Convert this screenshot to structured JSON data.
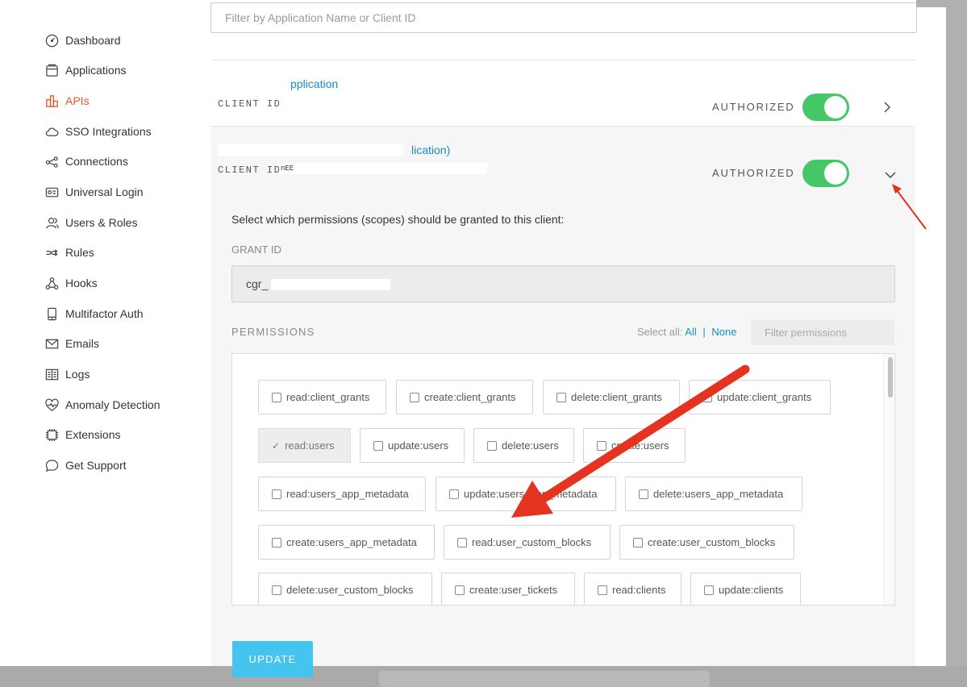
{
  "sidebar": {
    "items": [
      {
        "label": "Dashboard",
        "icon": "dashboard-icon",
        "active": false
      },
      {
        "label": "Applications",
        "icon": "applications-icon",
        "active": false
      },
      {
        "label": "APIs",
        "icon": "apis-icon",
        "active": true
      },
      {
        "label": "SSO Integrations",
        "icon": "cloud-icon",
        "active": false
      },
      {
        "label": "Connections",
        "icon": "connections-icon",
        "active": false
      },
      {
        "label": "Universal Login",
        "icon": "universal-login-icon",
        "active": false
      },
      {
        "label": "Users & Roles",
        "icon": "users-icon",
        "active": false
      },
      {
        "label": "Rules",
        "icon": "rules-icon",
        "active": false
      },
      {
        "label": "Hooks",
        "icon": "hooks-icon",
        "active": false
      },
      {
        "label": "Multifactor Auth",
        "icon": "phone-icon",
        "active": false
      },
      {
        "label": "Emails",
        "icon": "email-icon",
        "active": false
      },
      {
        "label": "Logs",
        "icon": "logs-icon",
        "active": false
      },
      {
        "label": "Anomaly Detection",
        "icon": "heart-icon",
        "active": false
      },
      {
        "label": "Extensions",
        "icon": "extensions-icon",
        "active": false
      },
      {
        "label": "Get Support",
        "icon": "chat-bubble-icon",
        "active": false
      }
    ]
  },
  "search": {
    "placeholder": "Filter by Application Name or Client ID"
  },
  "apps": [
    {
      "name_visible": "pplication",
      "client_id_label": "CLIENT ID:",
      "client_id_visible": "",
      "status": "AUTHORIZED",
      "authorized": true,
      "expanded": false
    },
    {
      "name_visible": "lication)",
      "client_id_label": "CLIENT ID:",
      "client_id_visible": "nEE",
      "status": "AUTHORIZED",
      "authorized": true,
      "expanded": true
    }
  ],
  "panel": {
    "title": "Select which permissions (scopes) should be granted to this client:",
    "grant_label": "GRANT ID",
    "grant_value": "cgr_",
    "permissions_label": "PERMISSIONS",
    "select_all_label": "Select all:",
    "all_label": "All",
    "separator": "|",
    "none_label": "None",
    "filter_placeholder": "Filter permissions",
    "permissions": [
      {
        "label": "read:client_grants",
        "checked": false
      },
      {
        "label": "create:client_grants",
        "checked": false
      },
      {
        "label": "delete:client_grants",
        "checked": false
      },
      {
        "label": "update:client_grants",
        "checked": false
      },
      {
        "label": "read:users",
        "checked": true
      },
      {
        "label": "update:users",
        "checked": false
      },
      {
        "label": "delete:users",
        "checked": false
      },
      {
        "label": "create:users",
        "checked": false
      },
      {
        "label": "read:users_app_metadata",
        "checked": false
      },
      {
        "label": "update:users_app_metadata",
        "checked": false
      },
      {
        "label": "delete:users_app_metadata",
        "checked": false
      },
      {
        "label": "create:users_app_metadata",
        "checked": false
      },
      {
        "label": "read:user_custom_blocks",
        "checked": false
      },
      {
        "label": "create:user_custom_blocks",
        "checked": false
      },
      {
        "label": "delete:user_custom_blocks",
        "checked": false
      },
      {
        "label": "create:user_tickets",
        "checked": false
      },
      {
        "label": "read:clients",
        "checked": false
      },
      {
        "label": "update:clients",
        "checked": false
      }
    ],
    "update_label": "UPDATE"
  },
  "colors": {
    "accent": "#168dc0",
    "active_nav": "#eb5424",
    "toggle_on": "#44c767",
    "update_button": "#44c4ee",
    "annotation_arrow": "#e53322"
  }
}
